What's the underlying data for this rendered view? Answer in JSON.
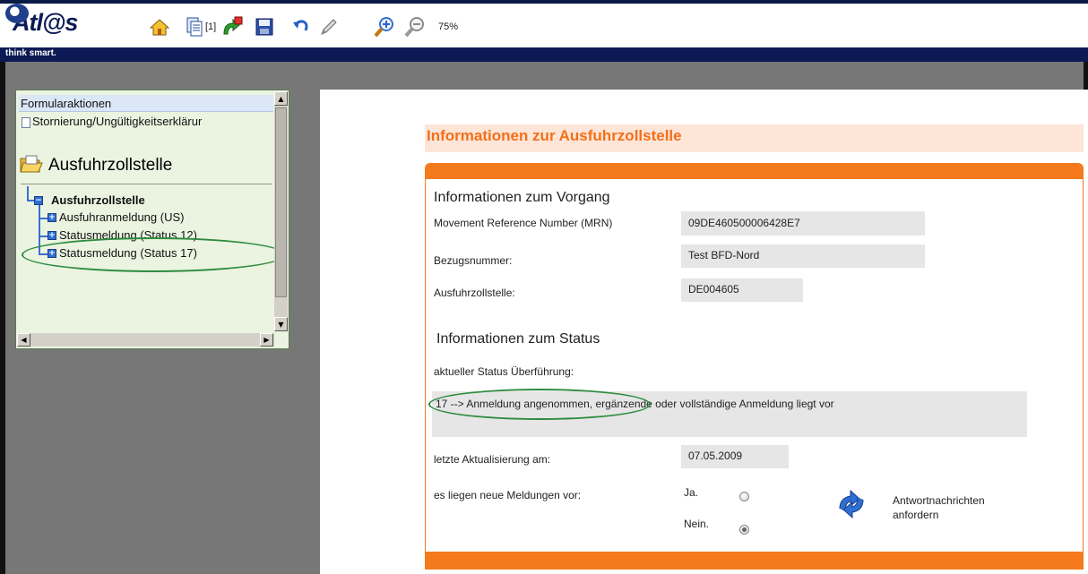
{
  "app": {
    "logo_text": "Atl@s",
    "tagline": "think smart."
  },
  "toolbar": {
    "page_indicator": "[1]",
    "zoom_label": "75%"
  },
  "sidebar": {
    "actions_header": "Formularaktionen",
    "storno_item": "Stornierung/Ungültigkeitserklärur",
    "section_title": "Ausfuhrzollstelle",
    "tree_root": "Ausfuhrzollstelle",
    "tree_items": [
      "Ausfuhranmeldung  (US)",
      "Statusmeldung (Status 12)",
      "Statusmeldung (Status 17)"
    ]
  },
  "form": {
    "title": "Informationen zur Ausfuhrzollstelle",
    "procedure_header": "Informationen zum Vorgang",
    "mrn_label": "Movement Reference Number (MRN)",
    "mrn_value": "09DE460500006428E7",
    "reference_label": "Bezugsnummer:",
    "reference_value": "Test BFD-Nord",
    "office_label": "Ausfuhrzollstelle:",
    "office_value": "DE004605",
    "status_header": "Informationen zum Status",
    "status_label": "aktueller Status Überführung:",
    "status_value": "17 --> Anmeldung angenommen, ergänzende oder vollständige Anmeldung liegt vor",
    "updated_label": "letzte Aktualisierung am:",
    "updated_value": "07.05.2009",
    "new_messages_label": "es liegen neue Meldungen vor:",
    "option_yes": "Ja.",
    "option_no": "Nein.",
    "selected_option": "Nein.",
    "request_replies_label": "Antwortnachrichten anfordern"
  },
  "colors": {
    "accent_orange": "#f47a1d",
    "title_orange": "#f36f18",
    "header_navy": "#0b1a55",
    "panel_green": "#ebf4e1",
    "annotation_green": "#2e8b3e"
  },
  "icons": [
    "home-icon",
    "document-list-icon",
    "refresh-cursor-icon",
    "save-icon",
    "undo-icon",
    "pencil-icon",
    "zoom-in-icon",
    "zoom-out-icon",
    "page-icon",
    "folder-open-icon",
    "refresh-arrows-icon"
  ]
}
